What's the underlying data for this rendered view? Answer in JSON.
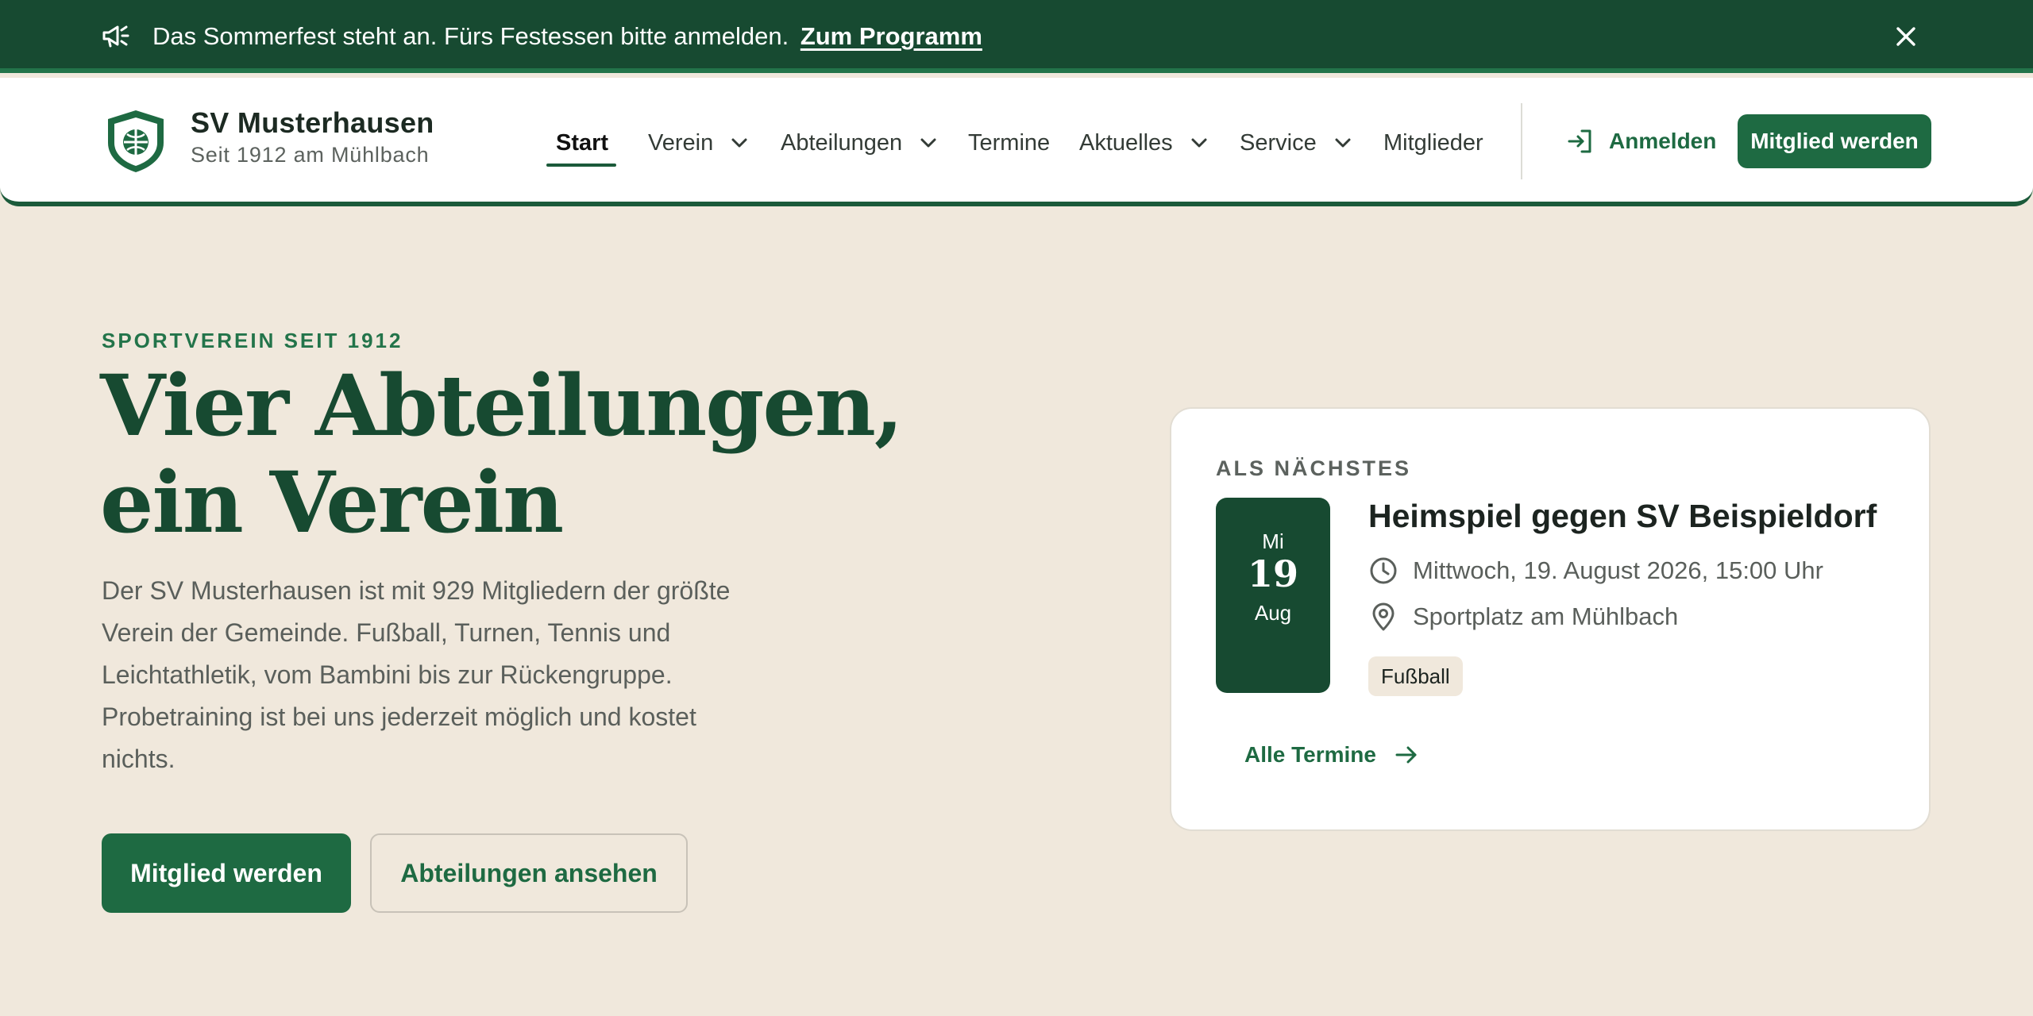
{
  "announcement": {
    "text": "Das Sommerfest steht an. Fürs Festessen bitte anmelden.",
    "link_label": "Zum Programm"
  },
  "brand": {
    "name": "SV Musterhausen",
    "tagline": "Seit 1912 am Mühlbach"
  },
  "nav": {
    "items": [
      {
        "label": "Start",
        "active": true,
        "has_dropdown": false
      },
      {
        "label": "Verein",
        "has_dropdown": true
      },
      {
        "label": "Abteilungen",
        "has_dropdown": true
      },
      {
        "label": "Termine",
        "has_dropdown": false
      },
      {
        "label": "Aktuelles",
        "has_dropdown": true
      },
      {
        "label": "Service",
        "has_dropdown": true
      },
      {
        "label": "Mitglieder",
        "has_dropdown": false
      }
    ],
    "login_label": "Anmelden",
    "cta_label": "Mitglied werden"
  },
  "hero": {
    "eyebrow": "SPORTVEREIN SEIT 1912",
    "title": "Vier Abteilungen, ein Verein",
    "description": "Der SV Musterhausen ist mit 929 Mitgliedern der größte Verein der Gemeinde. Fußball, Turnen, Tennis und Leichtathletik, vom Bambini bis zur Rückengruppe. Probetraining ist bei uns jederzeit möglich und kostet nichts.",
    "primary_button": "Mitglied werden",
    "secondary_button": "Abteilungen ansehen"
  },
  "next_event": {
    "eyebrow": "ALS NÄCHSTES",
    "weekday_short": "Mi",
    "day": "19",
    "month_short": "Aug",
    "title": "Heimspiel gegen SV Beispieldorf",
    "datetime": "Mittwoch, 19. August 2026, 15:00 Uhr",
    "location": "Sportplatz am Mühlbach",
    "tag": "Fußball",
    "all_link": "Alle Termine"
  },
  "colors": {
    "brand_dark": "#174a31",
    "brand": "#1e6a42",
    "background": "#f0e8dc"
  },
  "icons": {
    "announcement": "megaphone-icon",
    "close": "close-icon",
    "login": "login-icon",
    "time": "clock-icon",
    "location": "map-pin-icon",
    "link": "arrow-right-icon"
  }
}
